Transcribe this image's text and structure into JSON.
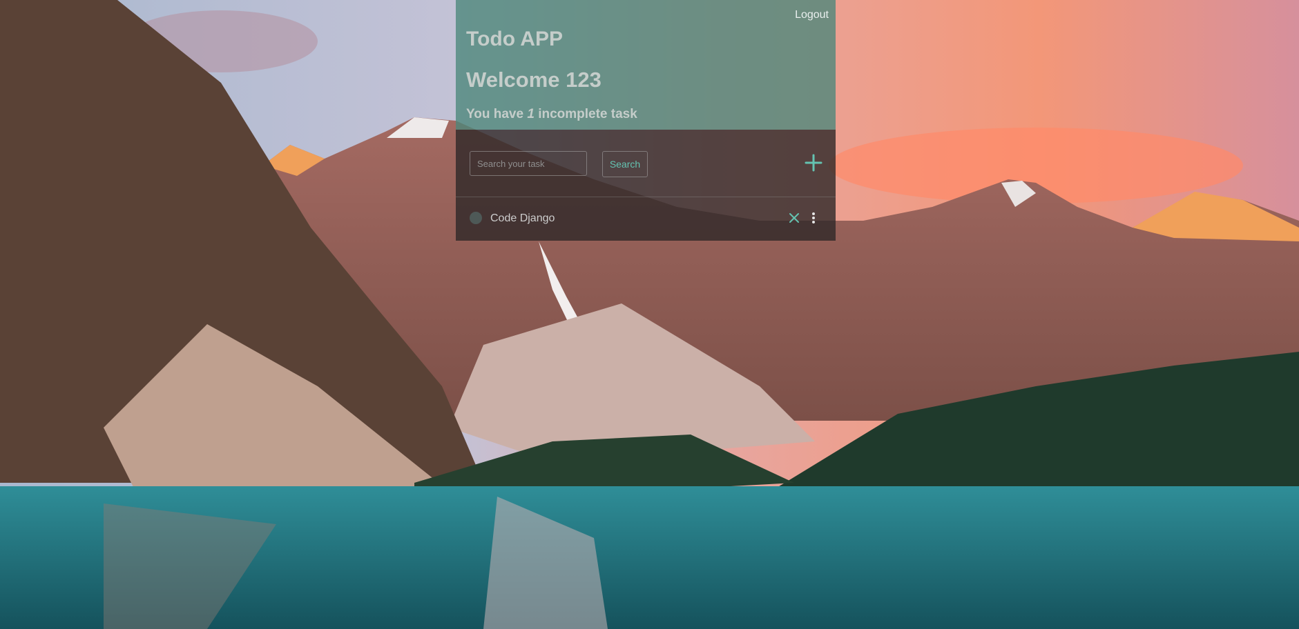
{
  "header": {
    "logout_label": "Logout",
    "app_title": "Todo APP",
    "welcome_text": "Welcome 123",
    "summary_prefix": "You have",
    "incomplete_count": "1",
    "summary_suffix": "incomplete task"
  },
  "search": {
    "placeholder": "Search your task",
    "value": "",
    "button_label": "Search"
  },
  "add_button": {
    "icon": "plus-icon"
  },
  "tasks": [
    {
      "label": "Code Django",
      "completed": false,
      "icons": [
        "circle-checkbox-icon",
        "close-icon",
        "vertical-dots-icon"
      ]
    }
  ],
  "colors": {
    "header_overlay": "#4a867a",
    "body_overlay": "#2e2828",
    "accent": "#64c3b1",
    "heading_text": "#c5cdca"
  }
}
